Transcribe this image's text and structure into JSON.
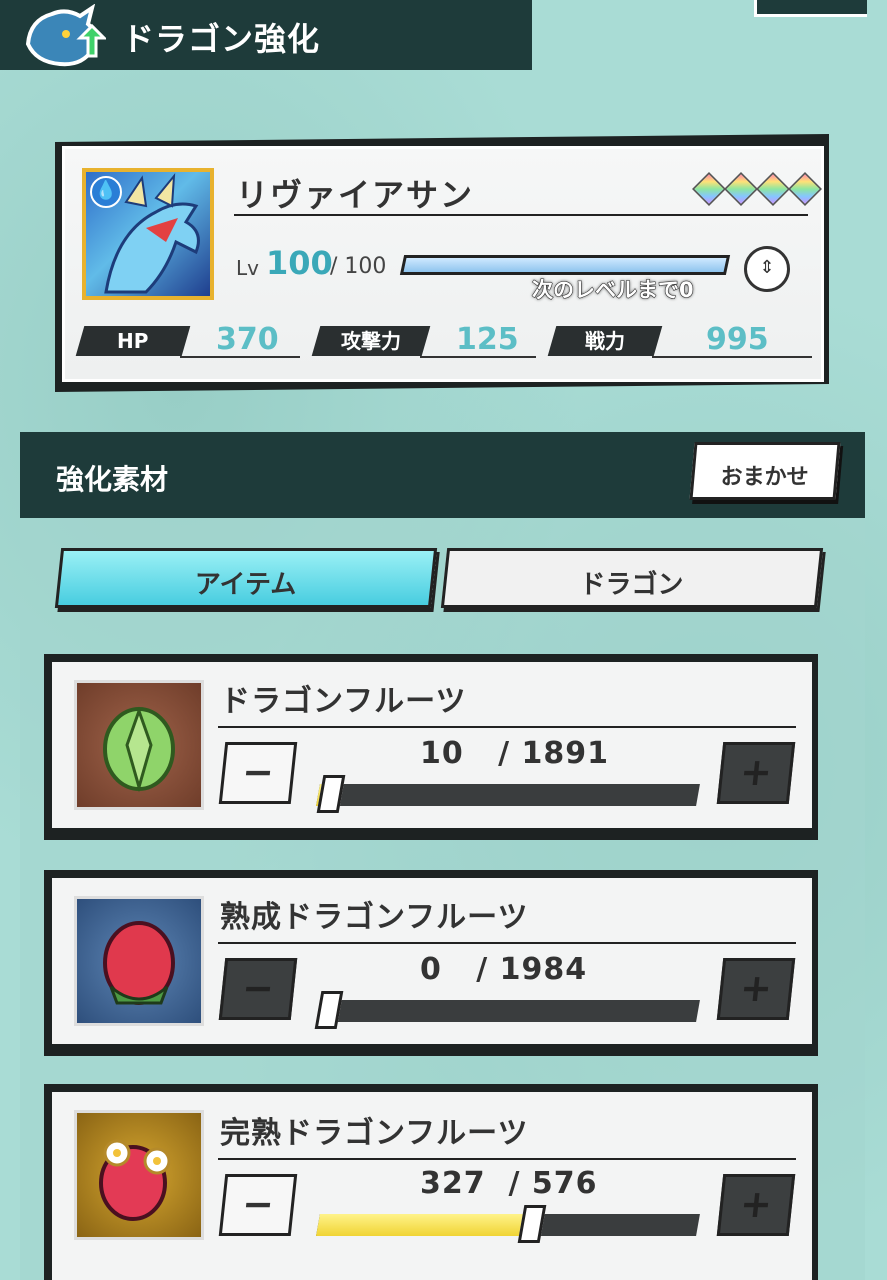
{
  "header": {
    "title": "ドラゴン強化",
    "icon": "dragon-upgrade-icon"
  },
  "dragon": {
    "name": "リヴァイアサン",
    "element_icon": "water-element-icon",
    "stars": 4,
    "lv_label": "Lv",
    "level": "100",
    "level_max": "/ 100",
    "next_level_text": "次のレベルまで0",
    "exp_fraction": 1.0,
    "stats": [
      {
        "label": "HP",
        "value": "370"
      },
      {
        "label": "攻撃力",
        "value": "125"
      },
      {
        "label": "戦力",
        "value": "995"
      }
    ]
  },
  "materials": {
    "title": "強化素材",
    "auto_button": "おまかせ",
    "tabs": [
      {
        "label": "アイテム",
        "active": true
      },
      {
        "label": "ドラゴン",
        "active": false
      }
    ],
    "items": [
      {
        "name": "ドラゴンフルーツ",
        "count": "10",
        "max": "/ 1891",
        "fraction": 0.005,
        "icon": "green-dragon-fruit-icon",
        "minus_enabled": true
      },
      {
        "name": "熟成ドラゴンフルーツ",
        "count": "0",
        "max": "/ 1984",
        "fraction": 0.0,
        "icon": "red-dragon-fruit-icon",
        "minus_enabled": false
      },
      {
        "name": "完熟ドラゴンフルーツ",
        "count": "327",
        "max": "/ 576",
        "fraction": 0.568,
        "icon": "ripe-dragon-fruit-icon",
        "minus_enabled": true
      }
    ],
    "minus_symbol": "−",
    "plus_symbol": "+"
  },
  "colors": {
    "accent": "#5cbec6",
    "panel_dark": "#1e3b3a",
    "tab_active": "#48cde0",
    "slider_fill": "#f0d434"
  }
}
